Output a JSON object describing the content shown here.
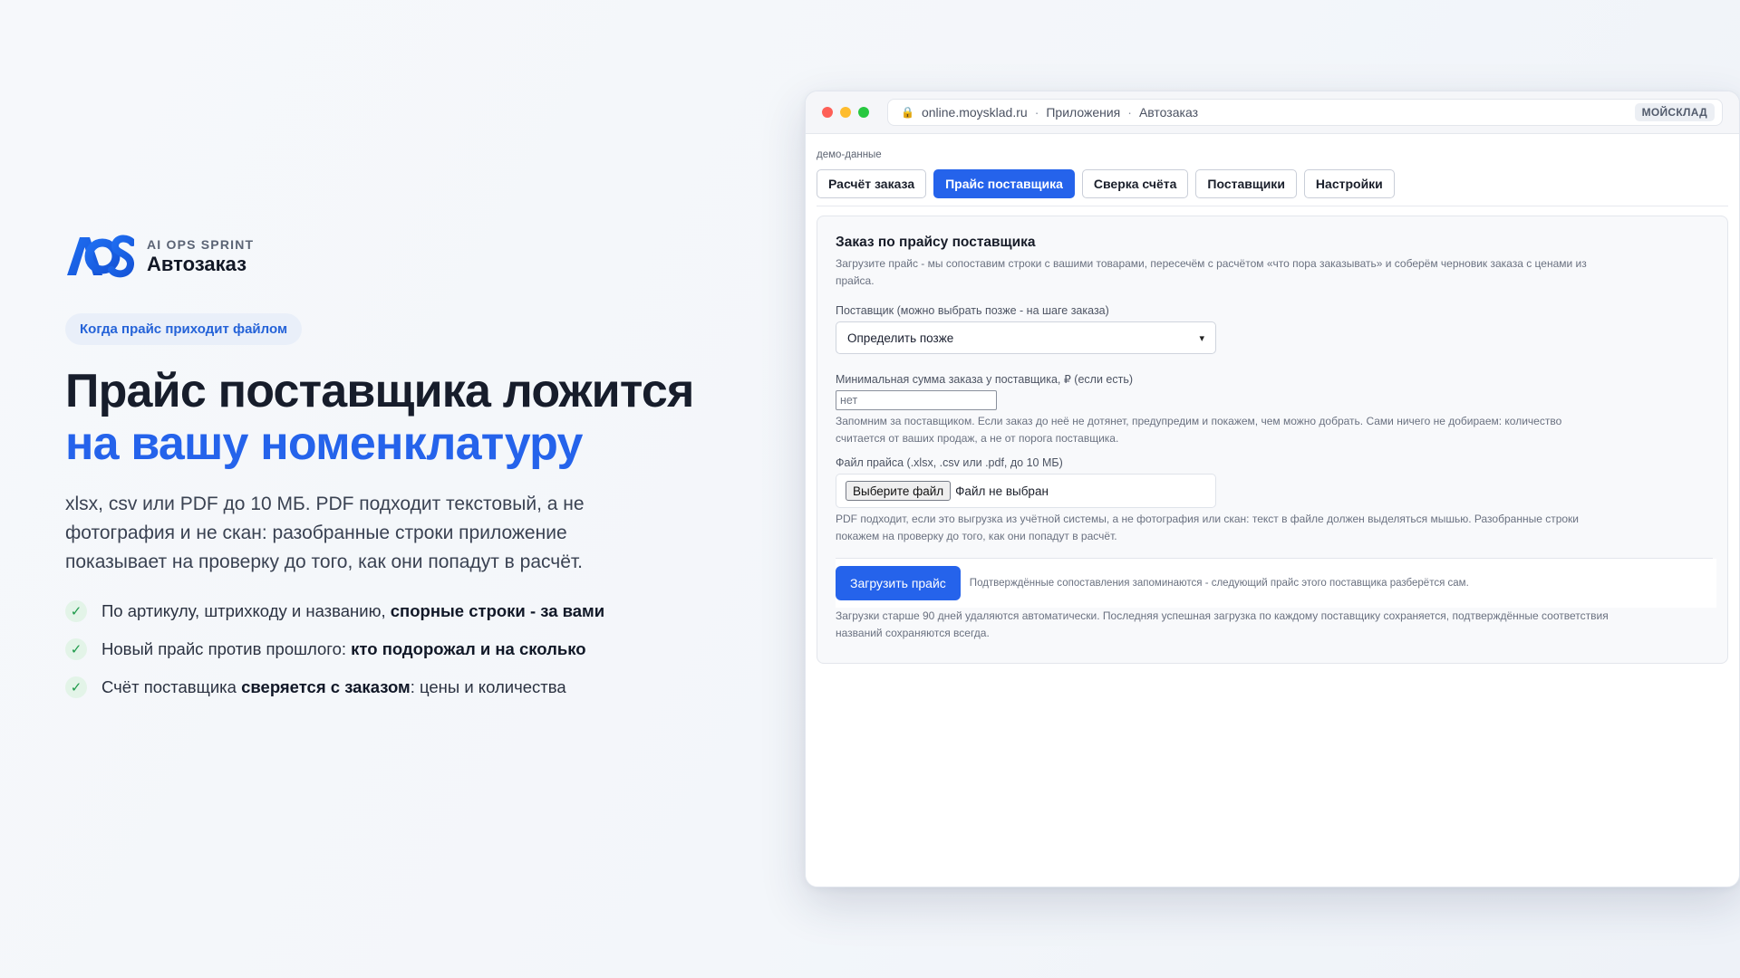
{
  "promo": {
    "logo_text": "AOS",
    "kicker": "AI OPS SPRINT",
    "product": "Автозаказ",
    "pill": "Когда прайс приходит файлом",
    "headline_line1": "Прайс поставщика ложится",
    "headline_line2": "на вашу номенклатуру",
    "lead": "xlsx, csv или PDF до 10 МБ. PDF подходит текстовый, а не фотография и не скан: разобранные строки приложение показывает на проверку до того, как они попадут в расчёт.",
    "features": [
      {
        "pre": "По артикулу, штрихкоду и названию, ",
        "bold": "спорные строки - за вами",
        "post": ""
      },
      {
        "pre": "Новый прайс против прошлого: ",
        "bold": "кто подорожал и на сколько",
        "post": ""
      },
      {
        "pre": "Счёт поставщика ",
        "bold": "сверяется с заказом",
        "post": ": цены и количества"
      }
    ],
    "check_glyph": "✓"
  },
  "browser": {
    "url_host": "online.moysklad.ru",
    "url_part2": "Приложения",
    "url_part3": "Автозаказ",
    "url_sep": "·",
    "badge": "МОЙСКЛАД",
    "demo_label": "демо-данные",
    "tabs": [
      {
        "label": "Расчёт заказа",
        "active": false
      },
      {
        "label": "Прайс поставщика",
        "active": true
      },
      {
        "label": "Сверка счёта",
        "active": false
      },
      {
        "label": "Поставщики",
        "active": false
      },
      {
        "label": "Настройки",
        "active": false
      }
    ],
    "card": {
      "title": "Заказ по прайсу поставщика",
      "intro": "Загрузите прайс - мы сопоставим строки с вашими товарами, пересечём с расчётом «что пора заказывать» и соберём черновик заказа с ценами из прайса.",
      "supplier_label": "Поставщик (можно выбрать позже - на шаге заказа)",
      "supplier_value": "Определить позже",
      "min_sum_label": "Минимальная сумма заказа у поставщика, ₽ (если есть)",
      "min_sum_placeholder": "нет",
      "min_sum_hint": "Запомним за поставщиком. Если заказ до неё не дотянет, предупредим и покажем, чем можно добрать. Сами ничего не добираем: количество считается от ваших продаж, а не от порога поставщика.",
      "file_label": "Файл прайса (.xlsx, .csv или .pdf, до 10 МБ)",
      "file_button": "Выберите файл",
      "file_status": "Файл не выбран",
      "file_hint": "PDF подходит, если это выгрузка из учётной системы, а не фотография или скан: текст в файле должен выделяться мышью. Разобранные строки покажем на проверку до того, как они попадут в расчёт.",
      "upload_button": "Загрузить прайс",
      "upload_note": "Подтверждённые сопоставления запоминаются - следующий прайс этого поставщика разберётся сам.",
      "retention_note": "Загрузки старше 90 дней удаляются автоматически. Последняя успешная загрузка по каждому поставщику сохраняется, подтверждённые соответствия названий сохраняются всегда."
    }
  },
  "colors": {
    "accent": "#2563eb",
    "check_bg": "#e3f4e8",
    "check_fg": "#1e9a4a"
  }
}
